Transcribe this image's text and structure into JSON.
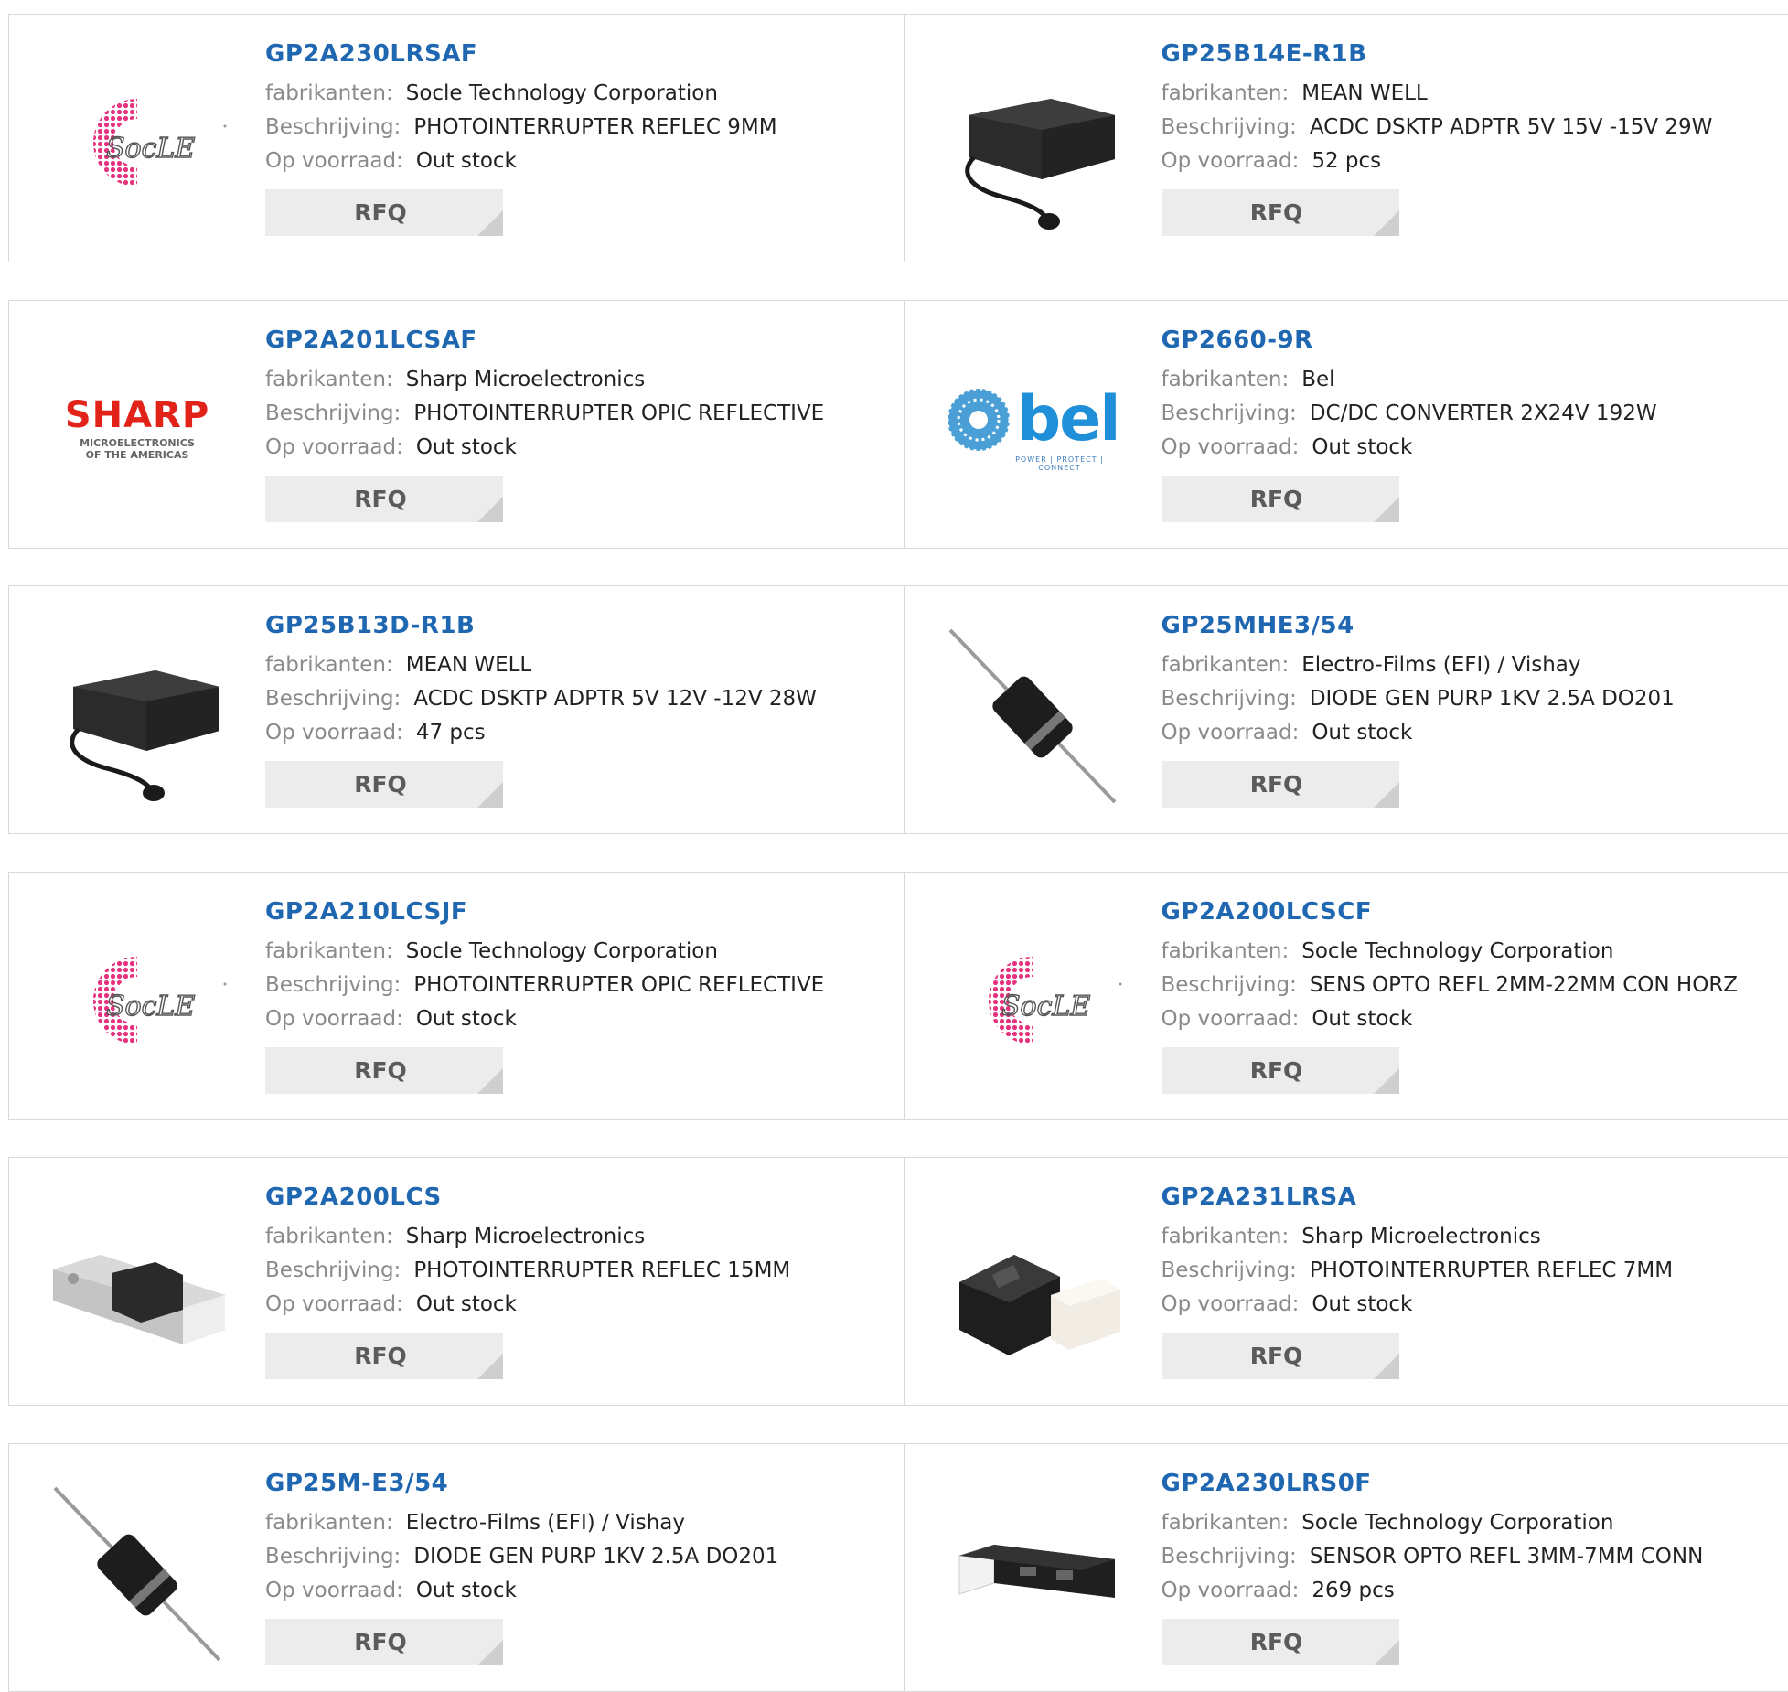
{
  "labels": {
    "manufacturer": "fabrikanten:",
    "description": "Beschrijving:",
    "stock": "Op voorraad:",
    "rfq": "RFQ"
  },
  "colors": {
    "link": "#1f67b1",
    "label": "#8a8a8a",
    "button_bg": "#ececec"
  },
  "rows": [
    [
      {
        "part": "GP2A230LRSAF",
        "manufacturer": "Socle Technology Corporation",
        "description": "PHOTOINTERRUPTER REFLEC 9MM",
        "stock": "Out stock",
        "image": "socle-logo"
      },
      {
        "part": "GP25B14E-R1B",
        "manufacturer": "MEAN WELL",
        "description": "ACDC DSKTP ADPTR 5V 15V -15V 29W",
        "stock": "52 pcs",
        "image": "power-adapter-photo"
      }
    ],
    [
      {
        "part": "GP2A201LCSAF",
        "manufacturer": "Sharp Microelectronics",
        "description": "PHOTOINTERRUPTER OPIC REFLECTIVE",
        "stock": "Out stock",
        "image": "sharp-logo",
        "logo_text": "SHARP",
        "logo_sub1": "MICROELECTRONICS",
        "logo_sub2": "OF THE AMERICAS"
      },
      {
        "part": "GP2660-9R",
        "manufacturer": "Bel",
        "description": "DC/DC CONVERTER 2X24V 192W",
        "stock": "Out stock",
        "image": "bel-logo",
        "logo_text": "bel",
        "logo_sub1": "POWER | PROTECT | CONNECT"
      }
    ],
    [
      {
        "part": "GP25B13D-R1B",
        "manufacturer": "MEAN WELL",
        "description": "ACDC DSKTP ADPTR 5V 12V -12V 28W",
        "stock": "47 pcs",
        "image": "power-adapter-photo"
      },
      {
        "part": "GP25MHE3/54",
        "manufacturer": "Electro-Films (EFI) / Vishay",
        "description": "DIODE GEN PURP 1KV 2.5A DO201",
        "stock": "Out stock",
        "image": "diode-photo"
      }
    ],
    [
      {
        "part": "GP2A210LCSJF",
        "manufacturer": "Socle Technology Corporation",
        "description": "PHOTOINTERRUPTER OPIC REFLECTIVE",
        "stock": "Out stock",
        "image": "socle-logo"
      },
      {
        "part": "GP2A200LCSCF",
        "manufacturer": "Socle Technology Corporation",
        "description": "SENS OPTO REFL 2MM-22MM CON HORZ",
        "stock": "Out stock",
        "image": "socle-logo"
      }
    ],
    [
      {
        "part": "GP2A200LCS",
        "manufacturer": "Sharp Microelectronics",
        "description": "PHOTOINTERRUPTER REFLEC 15MM",
        "stock": "Out stock",
        "image": "sensor-grey-photo"
      },
      {
        "part": "GP2A231LRSA",
        "manufacturer": "Sharp Microelectronics",
        "description": "PHOTOINTERRUPTER REFLEC 7MM",
        "stock": "Out stock",
        "image": "sensor-black-photo"
      }
    ],
    [
      {
        "part": "GP25M-E3/54",
        "manufacturer": "Electro-Films (EFI) / Vishay",
        "description": "DIODE GEN PURP 1KV 2.5A DO201",
        "stock": "Out stock",
        "image": "diode-photo"
      },
      {
        "part": "GP2A230LRS0F",
        "manufacturer": "Socle Technology Corporation",
        "description": "SENSOR OPTO REFL 3MM-7MM CONN",
        "stock": "269 pcs",
        "image": "sensor-black-white-photo"
      }
    ]
  ]
}
